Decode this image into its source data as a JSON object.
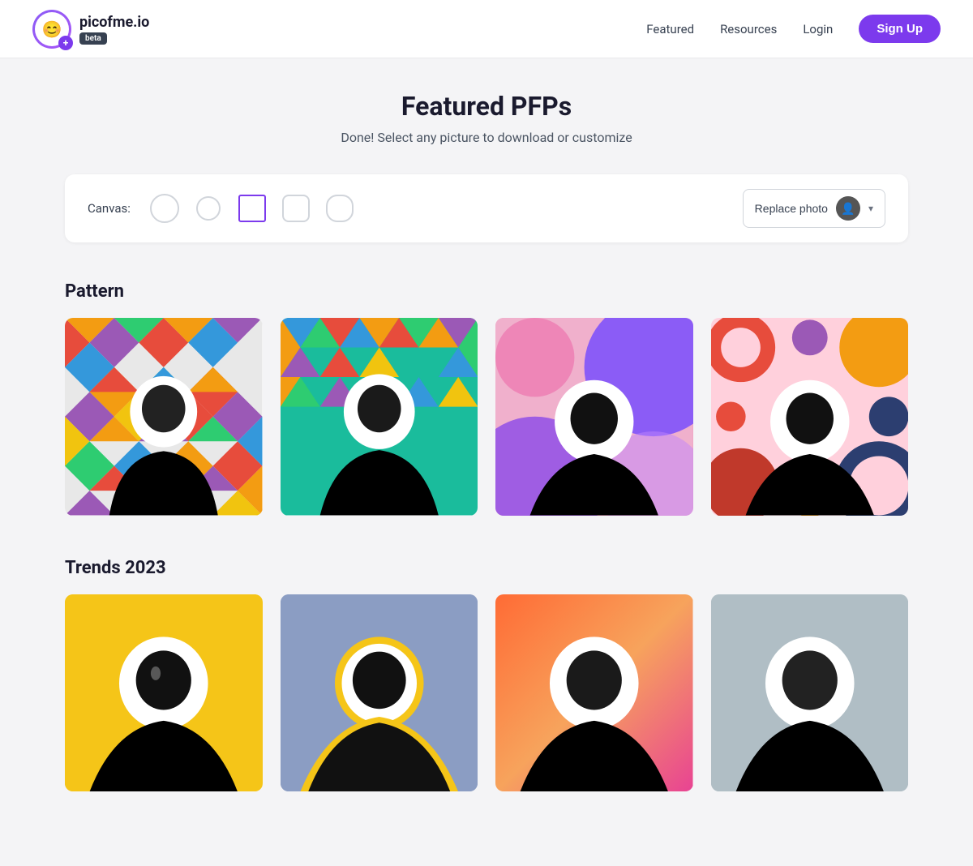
{
  "header": {
    "logo_text": "picofme.io",
    "beta_label": "beta",
    "nav": {
      "featured": "Featured",
      "resources": "Resources",
      "login": "Login",
      "signup": "Sign Up"
    }
  },
  "main": {
    "title": "Featured PFPs",
    "subtitle": "Done! Select any picture to download or customize",
    "canvas": {
      "label": "Canvas:",
      "replace_photo": "Replace photo"
    },
    "sections": [
      {
        "id": "pattern",
        "title": "Pattern",
        "items": [
          {
            "id": "p1",
            "bg": "multicolor-diamonds"
          },
          {
            "id": "p2",
            "bg": "multicolor-triangles"
          },
          {
            "id": "p3",
            "bg": "purple-circles-pink"
          },
          {
            "id": "p4",
            "bg": "retro-circles-dark"
          }
        ]
      },
      {
        "id": "trends",
        "title": "Trends 2023",
        "items": [
          {
            "id": "t1",
            "bg": "yellow-flat"
          },
          {
            "id": "t2",
            "bg": "purple-outline"
          },
          {
            "id": "t3",
            "bg": "orange-pink-gradient"
          },
          {
            "id": "t4",
            "bg": "light-blue-flat"
          }
        ]
      }
    ]
  }
}
